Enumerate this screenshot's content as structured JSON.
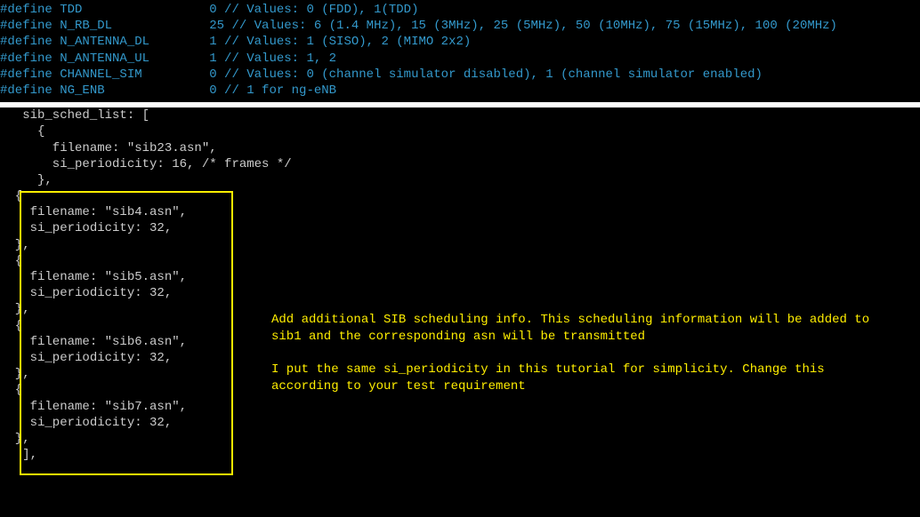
{
  "defines": [
    {
      "name": "#define TDD                 0 // Values: 0 (FDD), 1(TDD)"
    },
    {
      "name": "#define N_RB_DL             25 // Values: 6 (1.4 MHz), 15 (3MHz), 25 (5MHz), 50 (10MHz), 75 (15MHz), 100 (20MHz)"
    },
    {
      "name": "#define N_ANTENNA_DL        1 // Values: 1 (SISO), 2 (MIMO 2x2)"
    },
    {
      "name": "#define N_ANTENNA_UL        1 // Values: 1, 2"
    },
    {
      "name": "#define CHANNEL_SIM         0 // Values: 0 (channel simulator disabled), 1 (channel simulator enabled)"
    },
    {
      "name": "#define NG_ENB              0 // 1 for ng-eNB"
    }
  ],
  "code": [
    "   sib_sched_list: [",
    "     {",
    "       filename: \"sib23.asn\",",
    "       si_periodicity: 16, /* frames */",
    "     },",
    "  {",
    "    filename: \"sib4.asn\",",
    "    si_periodicity: 32,",
    "  },",
    "  {",
    "    filename: \"sib5.asn\",",
    "    si_periodicity: 32,",
    "  },",
    "  {",
    "    filename: \"sib6.asn\",",
    "    si_periodicity: 32,",
    "  },",
    "  {",
    "    filename: \"sib7.asn\",",
    "    si_periodicity: 32,",
    "  },",
    "   ],"
  ],
  "annotation": {
    "para1": "Add additional SIB scheduling info. This scheduling information will be added to sib1 and the corresponding asn will be transmitted",
    "para2": "I put the same si_periodicity in this tutorial for simplicity. Change this according to your test requirement"
  }
}
